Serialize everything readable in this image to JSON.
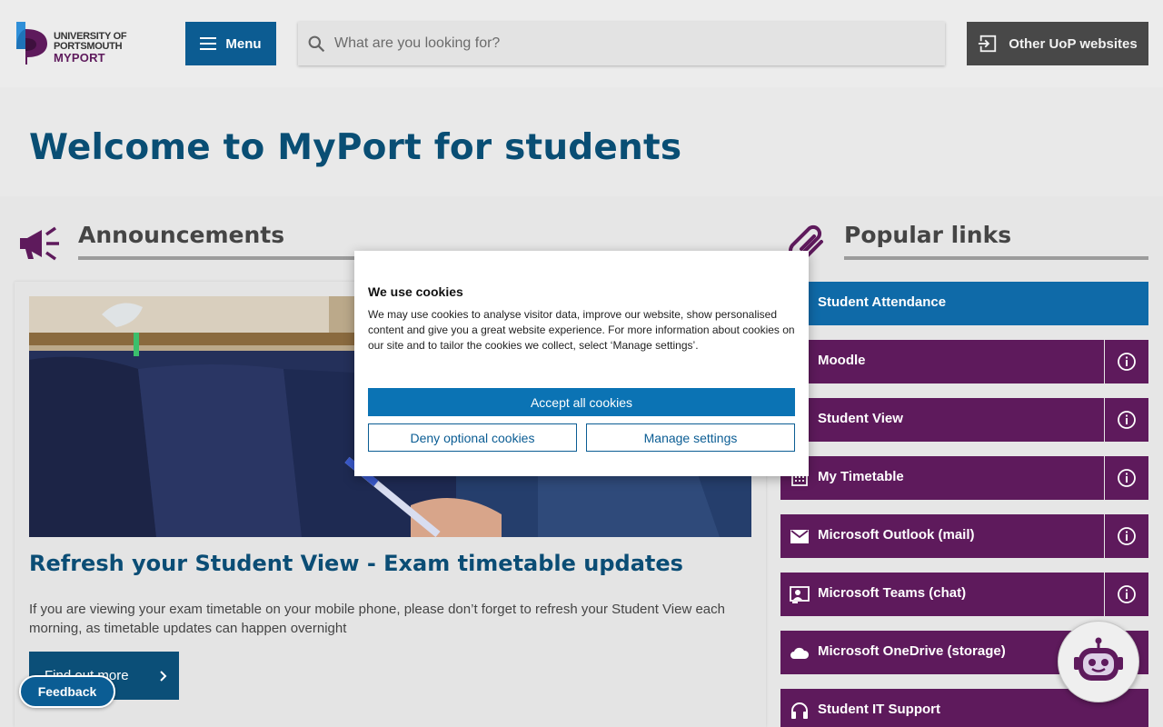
{
  "header": {
    "logo": {
      "line1": "UNIVERSITY OF",
      "line2": "PORTSMOUTH",
      "line3": "MYPORT"
    },
    "menu_label": "Menu",
    "search_placeholder": "What are you looking for?",
    "other_sites_label": "Other UoP websites"
  },
  "hero": {
    "title": "Welcome to MyPort for students"
  },
  "announcements": {
    "heading": "Announcements",
    "card": {
      "title": "Refresh your Student View - Exam timetable updates",
      "body": "If you are viewing your exam timetable on your mobile phone,  please don’t forget to refresh your Student View each morning, as timetable updates can happen overnight",
      "button": "Find out more"
    }
  },
  "popular_links": {
    "heading": "Popular links",
    "items": [
      {
        "label": "Student Attendance",
        "icon": "attendance-icon",
        "active": true,
        "info": false
      },
      {
        "label": "Moodle",
        "icon": "moodle-icon",
        "active": false,
        "info": true
      },
      {
        "label": "Student View",
        "icon": "student-view-icon",
        "active": false,
        "info": true
      },
      {
        "label": "My Timetable",
        "icon": "calendar-icon",
        "active": false,
        "info": true
      },
      {
        "label": "Microsoft Outlook (mail)",
        "icon": "mail-icon",
        "active": false,
        "info": true
      },
      {
        "label": "Microsoft Teams (chat)",
        "icon": "teams-icon",
        "active": false,
        "info": true
      },
      {
        "label": "Microsoft OneDrive (storage)",
        "icon": "cloud-icon",
        "active": false,
        "info": false
      },
      {
        "label": "Student IT Support",
        "icon": "headset-icon",
        "active": false,
        "info": false
      }
    ]
  },
  "feedback_label": "Feedback",
  "cookie_banner": {
    "title": "We use cookies",
    "text": "We may use cookies to analyse visitor data, improve our website, show personalised content and give you a great website experience. For more information about cookies on our site and to tailor the cookies we collect, select ‘Manage settings’.",
    "accept": "Accept all cookies",
    "deny": "Deny optional cookies",
    "manage": "Manage settings"
  },
  "colors": {
    "brand_blue": "#0c5c92",
    "brand_purple": "#5e1a5c",
    "title_blue": "#094e74"
  }
}
